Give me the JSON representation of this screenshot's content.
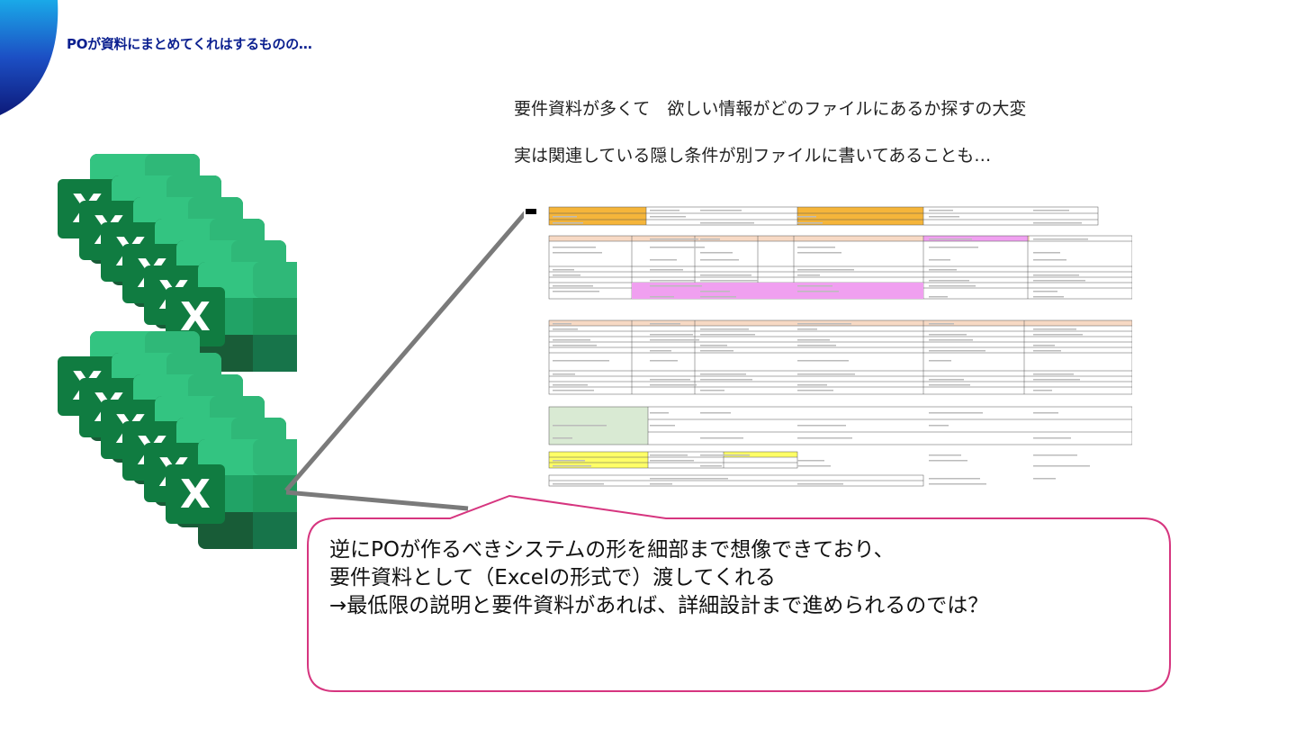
{
  "slide": {
    "title": "POが資料にまとめてくれはするものの…",
    "bullets": [
      "要件資料が多くて　欲しい情報がどのファイルにあるか探すの大変",
      "実は関連している隠し条件が別ファイルに書いてあることも…"
    ]
  },
  "excel_icons": {
    "letter": "X",
    "stacks": 2,
    "per_stack": 6,
    "icon": "excel-icon"
  },
  "callout": {
    "lines": [
      "逆にPOが作るべきシステムの形を細部まで想像できており、",
      "要件資料として（Excelの形式で）渡してくれる",
      "→最低限の説明と要件資料があれば、詳細設計まで進められるのでは？"
    ],
    "border_color": "#d6357f"
  },
  "colors": {
    "title": "#0a1f8f",
    "excel_dark": "#185c37",
    "excel_mid": "#21a366",
    "excel_light": "#33c481",
    "excel_badge": "#107c41",
    "highlight_orange": "#f5b53a",
    "highlight_pink": "#f0a0f0",
    "highlight_yellow": "#ffff66",
    "highlight_green": "#d9ead3",
    "connector": "#7a7a7a"
  }
}
